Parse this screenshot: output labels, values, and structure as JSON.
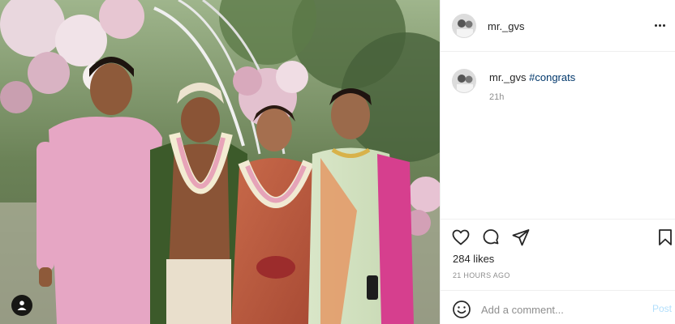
{
  "post": {
    "username": "mr._gvs",
    "caption": {
      "username": "mr._gvs",
      "hashtag": "#congrats",
      "time": "21h"
    },
    "likes": "284 likes",
    "time_ago": "21 HOURS AGO"
  },
  "comment": {
    "placeholder": "Add a comment...",
    "post_label": "Post"
  },
  "icons": {
    "more": "more-options-icon",
    "like": "heart-icon",
    "comment": "speech-bubble-icon",
    "share": "paper-plane-icon",
    "save": "bookmark-icon",
    "emoji": "smiley-icon",
    "tag": "user-tag-icon"
  },
  "colors": {
    "hashtag": "#00376b",
    "muted": "#8e8e8e",
    "post_button": "#b2dffc"
  }
}
